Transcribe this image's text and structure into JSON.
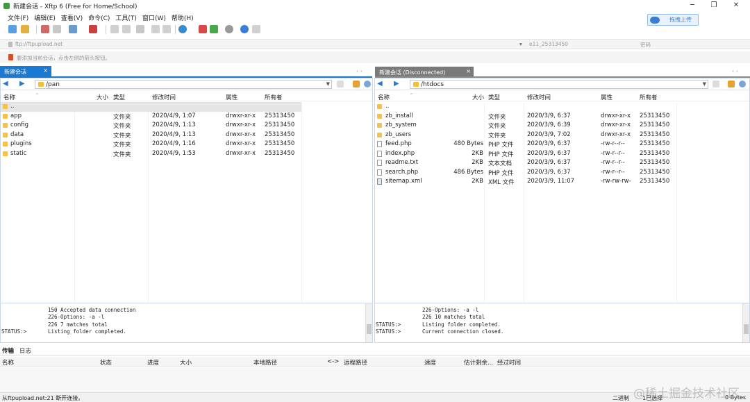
{
  "window": {
    "title": "新建会话 - Xftp 6 (Free for Home/School)",
    "controls": [
      "─",
      "❐",
      "✕"
    ]
  },
  "menu": [
    "文件(F)",
    "编辑(E)",
    "查看(V)",
    "命令(C)",
    "工具(T)",
    "窗口(W)",
    "帮助(H)"
  ],
  "drag_upload_label": "拖拽上传",
  "address": {
    "host_placeholder": "ftp://ftpupload.net",
    "user_placeholder": "e11_25313450",
    "password_placeholder": "密码"
  },
  "hint": "要添加当前会话，点击左侧的箭头按钮。",
  "tabs": {
    "left": {
      "label": "新建会话",
      "close": "×"
    },
    "right": {
      "label": "新建会话 (Disconnected)",
      "close": "×"
    },
    "nav": "‹ ›"
  },
  "left_pane": {
    "path": "/pan",
    "columns": [
      "名称",
      "大小",
      "类型",
      "修改时间",
      "属性",
      "所有者"
    ],
    "rows": [
      {
        "name": "..",
        "size": "",
        "type": "",
        "mtime": "",
        "attr": "",
        "owner": "",
        "kind": "folder",
        "selected": true
      },
      {
        "name": "app",
        "size": "",
        "type": "文件夹",
        "mtime": "2020/4/9, 1:07",
        "attr": "drwxr-xr-x",
        "owner": "25313450",
        "kind": "folder"
      },
      {
        "name": "config",
        "size": "",
        "type": "文件夹",
        "mtime": "2020/4/9, 1:13",
        "attr": "drwxr-xr-x",
        "owner": "25313450",
        "kind": "folder"
      },
      {
        "name": "data",
        "size": "",
        "type": "文件夹",
        "mtime": "2020/4/9, 1:13",
        "attr": "drwxr-xr-x",
        "owner": "25313450",
        "kind": "folder"
      },
      {
        "name": "plugins",
        "size": "",
        "type": "文件夹",
        "mtime": "2020/4/9, 1:16",
        "attr": "drwxr-xr-x",
        "owner": "25313450",
        "kind": "folder"
      },
      {
        "name": "static",
        "size": "",
        "type": "文件夹",
        "mtime": "2020/4/9, 1:53",
        "attr": "drwxr-xr-x",
        "owner": "25313450",
        "kind": "folder"
      }
    ],
    "log": [
      {
        "tag": "",
        "msg": "150 Accepted data connection"
      },
      {
        "tag": "",
        "msg": "226-Options: -a -l"
      },
      {
        "tag": "",
        "msg": "226 7 matches total"
      },
      {
        "tag": "STATUS:>",
        "msg": "Listing folder completed."
      }
    ]
  },
  "right_pane": {
    "path": "/htdocs",
    "columns": [
      "名称",
      "大小",
      "类型",
      "修改时间",
      "属性",
      "所有者"
    ],
    "rows": [
      {
        "name": "..",
        "size": "",
        "type": "",
        "mtime": "",
        "attr": "",
        "owner": "",
        "kind": "folder"
      },
      {
        "name": "zb_install",
        "size": "",
        "type": "文件夹",
        "mtime": "2020/3/9, 6:37",
        "attr": "drwxr-xr-x",
        "owner": "25313450",
        "kind": "folder"
      },
      {
        "name": "zb_system",
        "size": "",
        "type": "文件夹",
        "mtime": "2020/3/9, 6:39",
        "attr": "drwxr-xr-x",
        "owner": "25313450",
        "kind": "folder"
      },
      {
        "name": "zb_users",
        "size": "",
        "type": "文件夹",
        "mtime": "2020/3/9, 7:02",
        "attr": "drwxr-xr-x",
        "owner": "25313450",
        "kind": "folder"
      },
      {
        "name": "feed.php",
        "size": "480 Bytes",
        "type": "PHP 文件",
        "mtime": "2020/3/9, 6:37",
        "attr": "-rw-r--r--",
        "owner": "25313450",
        "kind": "file"
      },
      {
        "name": "index.php",
        "size": "2KB",
        "type": "PHP 文件",
        "mtime": "2020/3/9, 6:37",
        "attr": "-rw-r--r--",
        "owner": "25313450",
        "kind": "file"
      },
      {
        "name": "readme.txt",
        "size": "2KB",
        "type": "文本文档",
        "mtime": "2020/3/9, 6:37",
        "attr": "-rw-r--r--",
        "owner": "25313450",
        "kind": "file"
      },
      {
        "name": "search.php",
        "size": "486 Bytes",
        "type": "PHP 文件",
        "mtime": "2020/3/9, 6:37",
        "attr": "-rw-r--r--",
        "owner": "25313450",
        "kind": "file"
      },
      {
        "name": "sitemap.xml",
        "size": "2KB",
        "type": "XML 文件",
        "mtime": "2020/3/9, 11:07",
        "attr": "-rw-rw-rw-",
        "owner": "25313450",
        "kind": "xml"
      }
    ],
    "log": [
      {
        "tag": "",
        "msg": "226-Options: -a -l"
      },
      {
        "tag": "",
        "msg": "226 10 matches total"
      },
      {
        "tag": "STATUS:>",
        "msg": "Listing folder completed."
      },
      {
        "tag": "STATUS:>",
        "msg": "Current connection closed."
      }
    ]
  },
  "bottom_tabs": [
    "传输",
    "日志"
  ],
  "transfer_columns": [
    "名称",
    "状态",
    "进度",
    "大小",
    "本地路径",
    "<->",
    "远程路径",
    "速度",
    "估计剩余...",
    "经过时间"
  ],
  "status": {
    "message": "从ftpupload.net:21 断开连接。",
    "mode": "二进制",
    "selection": "1已选择",
    "bytes": "0 Bytes"
  },
  "watermark": "@稀土掘金技术社区",
  "colors": {
    "accent": "#1a7ad2",
    "folder": "#f2c14e",
    "status_text": "#2244aa"
  }
}
